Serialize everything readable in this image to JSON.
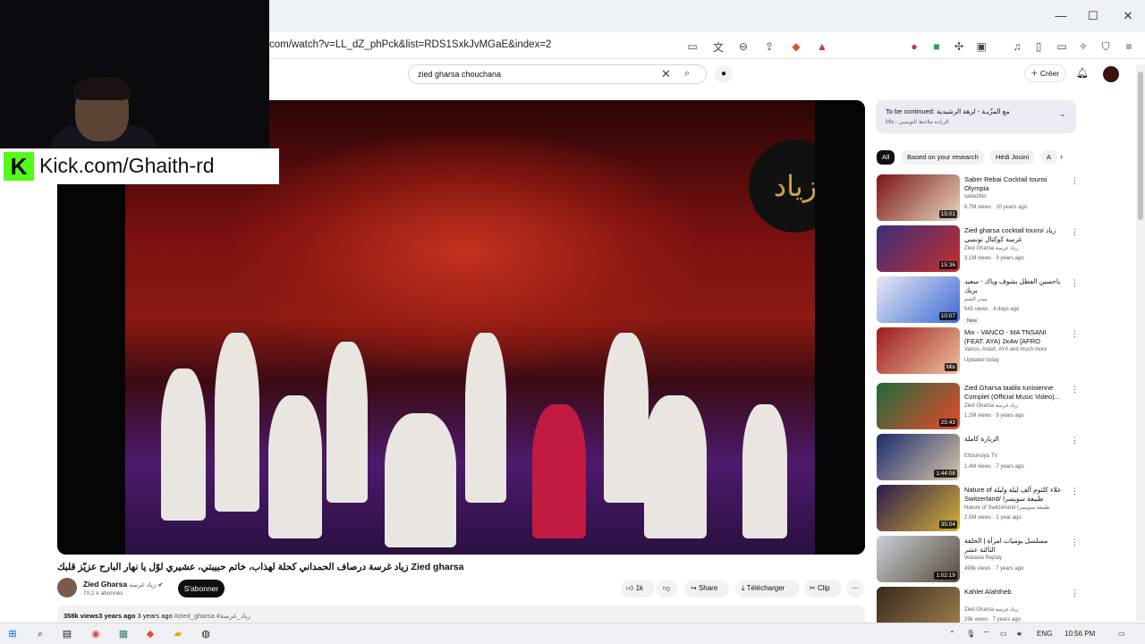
{
  "browser": {
    "url": "com/watch?v=LL_dZ_phPck&list=RDS1SxkJvMGaE&index=2",
    "window_controls": {
      "minimize": "—",
      "maximize": "☐",
      "close": "✕"
    }
  },
  "header": {
    "search_value": "zied gharsa chouchana",
    "create_label": "Créer"
  },
  "overlay": {
    "kick_text": "Kick.com/Ghaith-rd",
    "kick_logo": "K"
  },
  "video": {
    "title": "زياد غرسة درصاف الحمداني كحلة لهذاب، خاتم حبيبتي، عشيري لوّل يا نهار البارح عزيّز قلبك Zied gharsa",
    "channel_name": "Zied Gharsa",
    "channel_name_ar": "زياد غرسة",
    "subscribers": "70,2 k abonnés",
    "subscribe_label": "S'abonner",
    "likes": "1k",
    "share_label": "Share",
    "download_label": "Télécharger",
    "clip_label": "Clip",
    "views": "358k views",
    "uploaded": "3 years ago",
    "uploaded_dup": "3 years ago",
    "tags": "#zied_gharsa #زياد_غرسة"
  },
  "sidebar": {
    "mix": {
      "title": "To be continued: مع المزّيـة - لزهة الرشيدية",
      "subtitle": "Mix - الزيادة ملاحظ التونسي"
    },
    "chips": [
      {
        "label": "All",
        "active": true
      },
      {
        "label": "Based on your research",
        "active": false
      },
      {
        "label": "Hédi Jouini",
        "active": false
      },
      {
        "label": "A",
        "active": false
      }
    ],
    "recommendations": [
      {
        "title": "Saber Rebai Cocktail tounsi Olympia",
        "channel": "saba26tn",
        "views": "6.7M views · 10 years ago",
        "duration": "15:01",
        "colors": [
          "#7d1414",
          "#e8d8c0"
        ]
      },
      {
        "title": "Zied gharsa cocktail tounsi زياد غرسة كوكتال تونسي",
        "channel": "Zied Gharsa زياد غرسة",
        "views": "3.1M views · 9 years ago",
        "duration": "15:36",
        "colors": [
          "#3a2f7a",
          "#c42e2e"
        ]
      },
      {
        "title": "ياحسين الفطل بشوف وياك - سعيد بريك",
        "channel": "سدر الشم",
        "views": "545 views · 4 days ago",
        "duration": "10:07",
        "badge": "New",
        "colors": [
          "#e8e8f4",
          "#3d6ad6"
        ]
      },
      {
        "title": "Mix - VANCO - MA TNSANI (FEAT. AYA) 2ᴋ4ᴡ [AFRO HOUS...",
        "channel": "Vanco, Arash, AYA and much more",
        "views": "Updated today",
        "duration": "Mix",
        "colors": [
          "#9c1b1b",
          "#f0c2a0"
        ]
      },
      {
        "title": "Zied Gharsa taalila tunisienne Complet (Official Music Video)...",
        "channel": "Zied Gharsa زياد غرسة",
        "views": "1.2M views · 9 years ago",
        "duration": "25:43",
        "colors": [
          "#1d6a3c",
          "#e84a2a"
        ]
      },
      {
        "title": "الزيارة كاملة",
        "channel": "Ettounsiya TV",
        "views": "1.4M views · 7 years ago",
        "duration": "1:44:08",
        "colors": [
          "#1b2a6d",
          "#d8c8a8"
        ]
      },
      {
        "title": "Nature of علاء كلثوم ألف ليلة وليلة Switzerland/ طبيعة سويسرا",
        "channel": "Nature of Switzerland طبيعة سويسرا",
        "views": "2.5M views · 1 year ago",
        "duration": "35:04",
        "colors": [
          "#2a1a4a",
          "#d6b23a"
        ]
      },
      {
        "title": "مسلسل يوميات امرأة | الحلقة الثالثة عشر",
        "channel": "Watania Replay",
        "views": "499k views · 7 years ago",
        "duration": "1:02:19",
        "colors": [
          "#c8d0d8",
          "#5a4a3a"
        ]
      },
      {
        "title": "Kahlet Alahtheb",
        "channel": "Zied Gharsa زياد غرسة",
        "views": "29k views · 7 years ago",
        "duration": "",
        "colors": [
          "#3a2a1a",
          "#a08050"
        ]
      }
    ]
  },
  "taskbar": {
    "lang": "ENG",
    "time": "10:56 PM"
  }
}
